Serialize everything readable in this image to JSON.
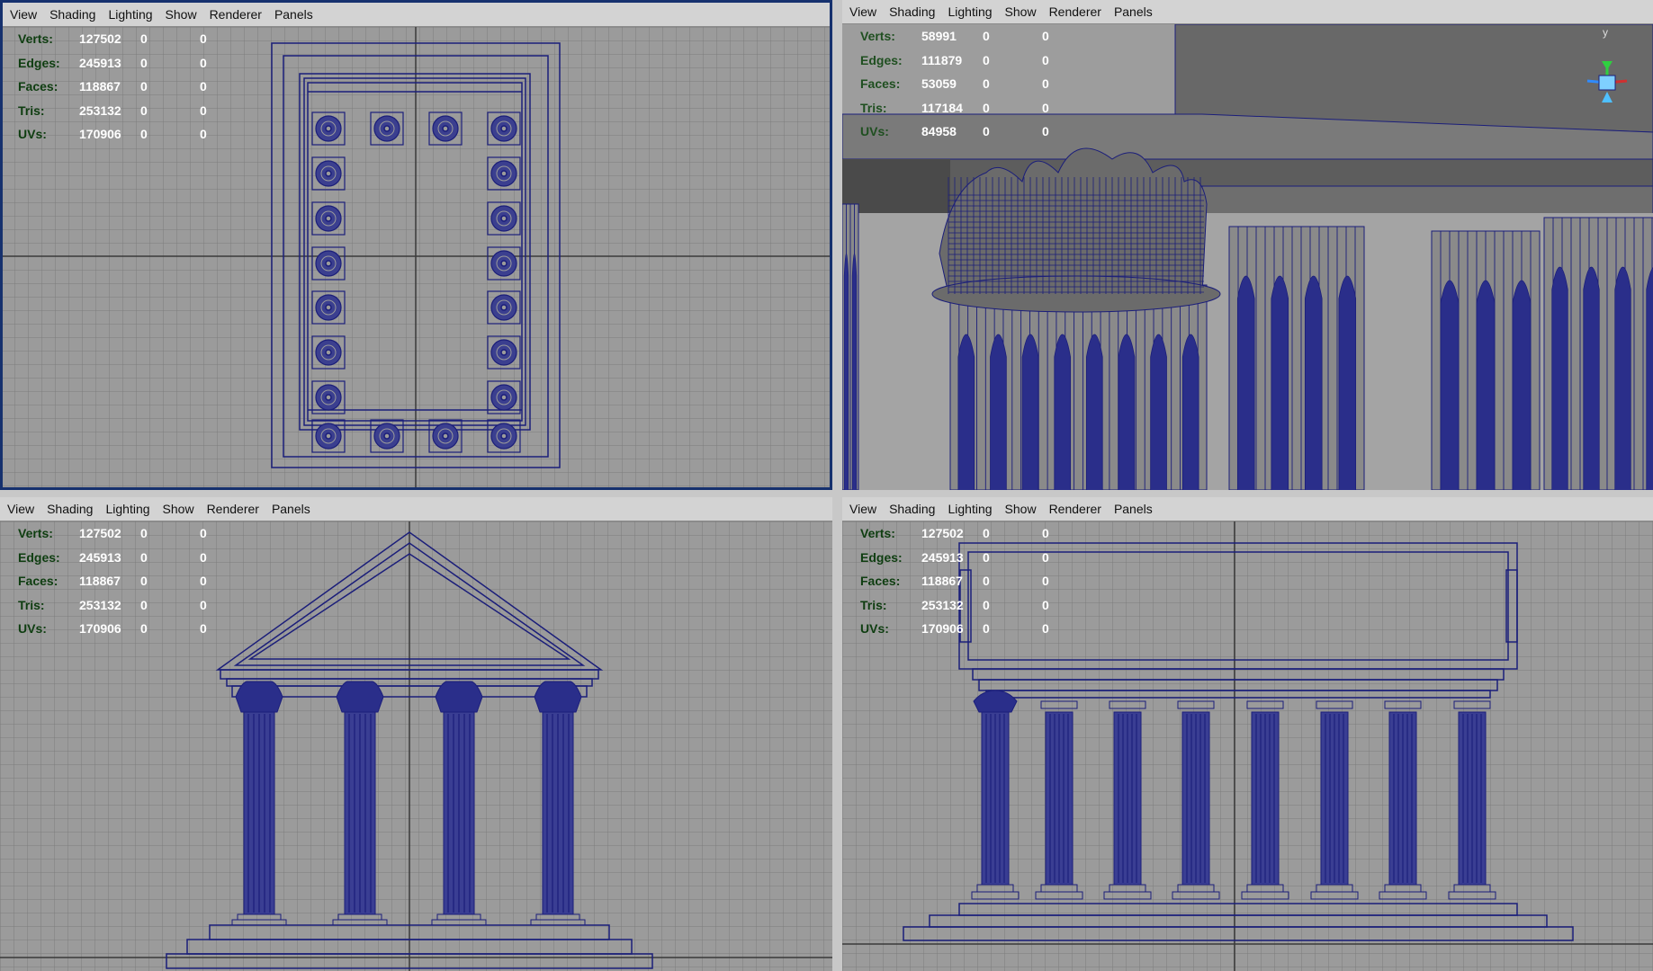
{
  "menu": [
    "View",
    "Shading",
    "Lighting",
    "Show",
    "Renderer",
    "Panels"
  ],
  "panes": [
    {
      "name": "top",
      "stats": [
        {
          "label": "Verts:",
          "v1": "127502",
          "v2": "0",
          "v3": "0"
        },
        {
          "label": "Edges:",
          "v1": "245913",
          "v2": "0",
          "v3": "0"
        },
        {
          "label": "Faces:",
          "v1": "118867",
          "v2": "0",
          "v3": "0"
        },
        {
          "label": "Tris:",
          "v1": "253132",
          "v2": "0",
          "v3": "0"
        },
        {
          "label": "UVs:",
          "v1": "170906",
          "v2": "0",
          "v3": "0"
        }
      ]
    },
    {
      "name": "persp",
      "stats": [
        {
          "label": "Verts:",
          "v1": "58991",
          "v2": "0",
          "v3": "0"
        },
        {
          "label": "Edges:",
          "v1": "111879",
          "v2": "0",
          "v3": "0"
        },
        {
          "label": "Faces:",
          "v1": "53059",
          "v2": "0",
          "v3": "0"
        },
        {
          "label": "Tris:",
          "v1": "117184",
          "v2": "0",
          "v3": "0"
        },
        {
          "label": "UVs:",
          "v1": "84958",
          "v2": "0",
          "v3": "0"
        }
      ]
    },
    {
      "name": "front",
      "stats": [
        {
          "label": "Verts:",
          "v1": "127502",
          "v2": "0",
          "v3": "0"
        },
        {
          "label": "Edges:",
          "v1": "245913",
          "v2": "0",
          "v3": "0"
        },
        {
          "label": "Faces:",
          "v1": "118867",
          "v2": "0",
          "v3": "0"
        },
        {
          "label": "Tris:",
          "v1": "253132",
          "v2": "0",
          "v3": "0"
        },
        {
          "label": "UVs:",
          "v1": "170906",
          "v2": "0",
          "v3": "0"
        }
      ]
    },
    {
      "name": "side",
      "stats": [
        {
          "label": "Verts:",
          "v1": "127502",
          "v2": "0",
          "v3": "0"
        },
        {
          "label": "Edges:",
          "v1": "245913",
          "v2": "0",
          "v3": "0"
        },
        {
          "label": "Faces:",
          "v1": "118867",
          "v2": "0",
          "v3": "0"
        },
        {
          "label": "Tris:",
          "v1": "253132",
          "v2": "0",
          "v3": "0"
        },
        {
          "label": "UVs:",
          "v1": "170906",
          "v2": "0",
          "v3": "0"
        }
      ]
    }
  ],
  "view_cube": {
    "axis_label": "y"
  },
  "colors": {
    "wire": "#1b1e7a",
    "grid": "#7d7d7d",
    "viewport_bg": "#9b9b9b",
    "active_border": "#16316e",
    "hud_label": "#0e3d10",
    "hud_value": "#ffffff"
  }
}
